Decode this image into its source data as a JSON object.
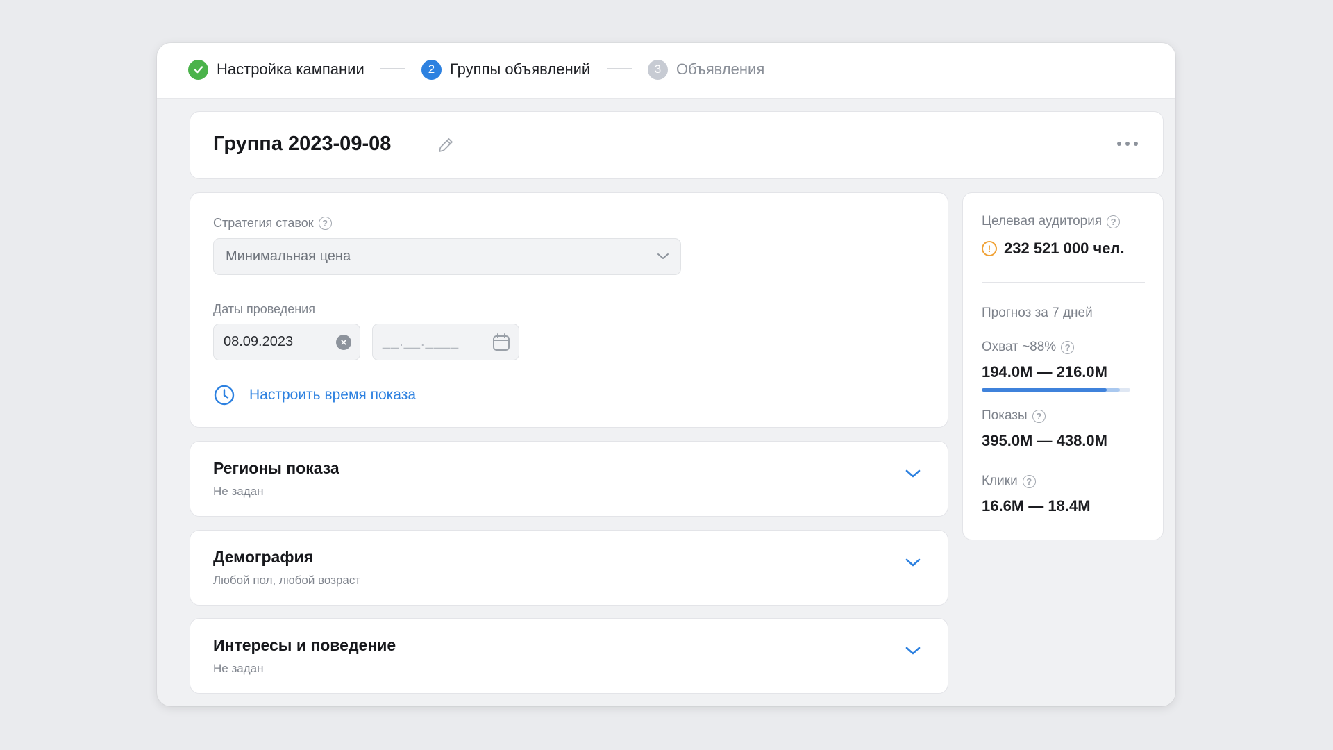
{
  "stepper": {
    "steps": [
      {
        "number": "✓",
        "label": "Настройка кампании",
        "state": "done"
      },
      {
        "number": "2",
        "label": "Группы объявлений",
        "state": "active"
      },
      {
        "number": "3",
        "label": "Объявления",
        "state": "pending"
      }
    ]
  },
  "group": {
    "title": "Группа 2023-09-08"
  },
  "strategy": {
    "label": "Стратегия ставок",
    "value": "Минимальная цена"
  },
  "dates": {
    "label": "Даты проведения",
    "from_value": "08.09.2023",
    "to_placeholder": "__.__.____"
  },
  "time_link": {
    "label": "Настроить время показа"
  },
  "sections": [
    {
      "title": "Регионы показа",
      "subtitle": "Не задан"
    },
    {
      "title": "Демография",
      "subtitle": "Любой пол, любой возраст"
    },
    {
      "title": "Интересы и поведение",
      "subtitle": "Не задан"
    }
  ],
  "audience": {
    "label": "Целевая аудитория",
    "value": "232 521 000 чел.",
    "forecast_label": "Прогноз за 7 дней",
    "reach_label": "Охват ~88%",
    "reach_value": "194.0M — 216.0M",
    "reach_fraction": 0.84,
    "reach_fraction_upper": 0.93,
    "impressions_label": "Показы",
    "impressions_value": "395.0M — 438.0M",
    "clicks_label": "Клики",
    "clicks_value": "16.6M — 18.4M"
  },
  "colors": {
    "accent": "#2d81e0",
    "success": "#4bb34b",
    "warning": "#f0a236"
  }
}
